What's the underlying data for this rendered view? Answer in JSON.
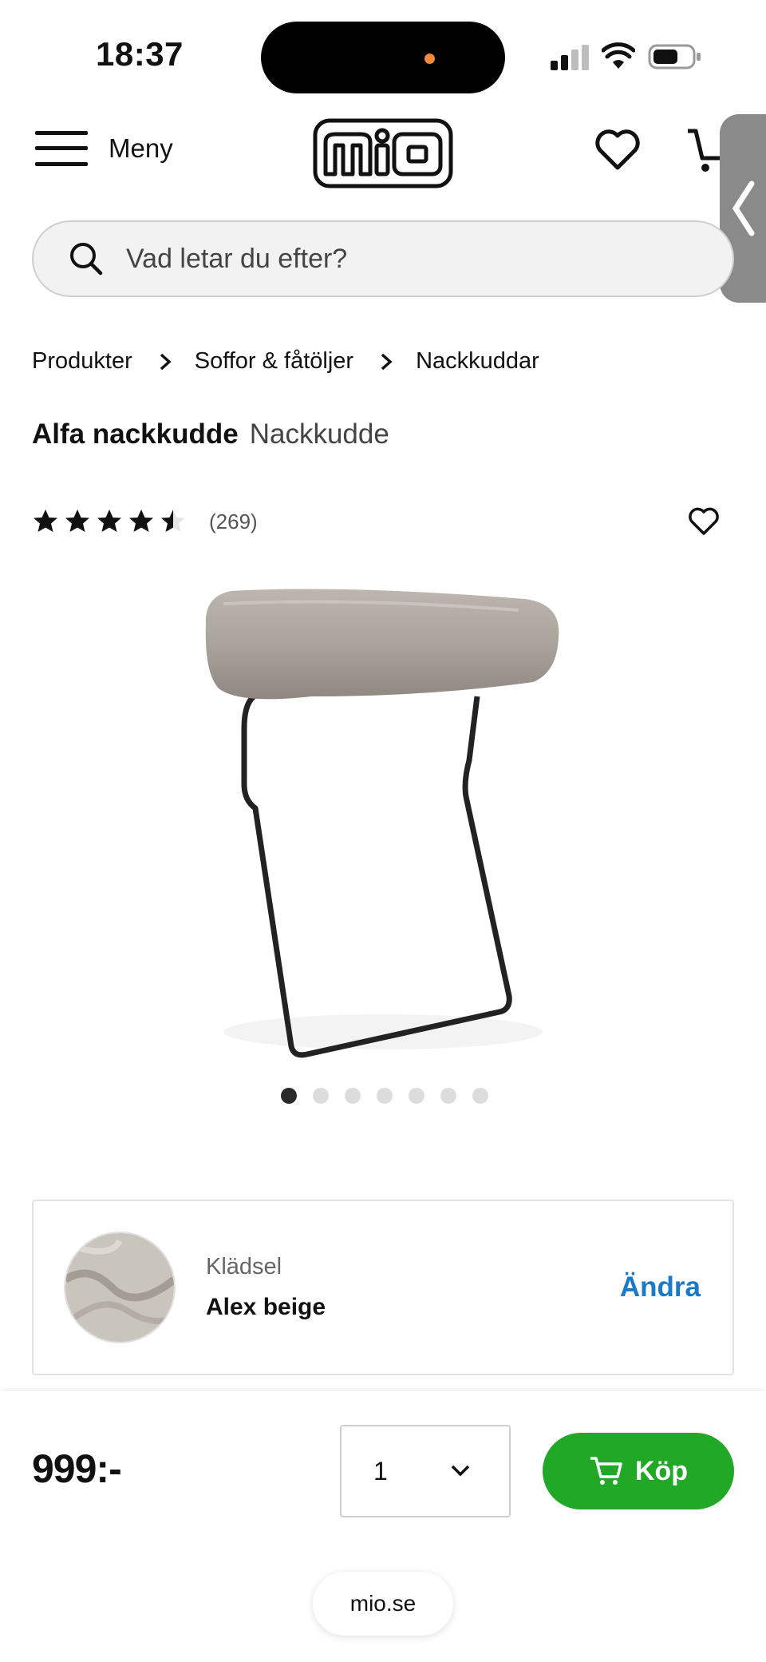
{
  "status_bar": {
    "time": "18:37"
  },
  "header": {
    "menu_label": "Meny",
    "logo_text": "mio"
  },
  "search": {
    "placeholder": "Vad letar du efter?"
  },
  "breadcrumb": [
    "Produkter",
    "Soffor & fåtöljer",
    "Nackkuddar"
  ],
  "product": {
    "name": "Alfa nackkudde",
    "type": "Nackkudde",
    "rating": 4.5,
    "rating_max": 5,
    "review_count": "(269)",
    "image_count": 7,
    "active_image": 1
  },
  "upholstery": {
    "label": "Klädsel",
    "value": "Alex beige",
    "change_label": "Ändra"
  },
  "purchase": {
    "price": "999:-",
    "quantity": "1",
    "buy_label": "Köp",
    "buy_color": "#21a826"
  },
  "browser": {
    "url": "mio.se"
  },
  "colors": {
    "accent_link": "#1a7ac7",
    "text": "#111111"
  }
}
